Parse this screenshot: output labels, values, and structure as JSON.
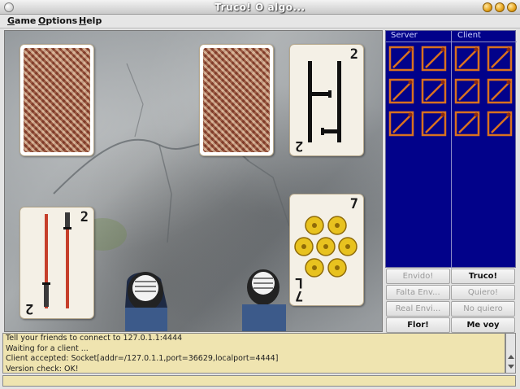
{
  "window": {
    "title": "Truco! O algo..."
  },
  "menu": [
    {
      "first": "G",
      "rest": "ame"
    },
    {
      "first": "O",
      "rest": "ptions"
    },
    {
      "first": "H",
      "rest": "elp"
    }
  ],
  "cards": {
    "opponent_played": {
      "rank": "2",
      "suit": "sword-icon"
    },
    "player_hand": {
      "rank": "2",
      "suit": "sword-icon"
    },
    "player_played": {
      "rank": "7",
      "suit": "coin-icon",
      "bottom_rank": "L"
    }
  },
  "score": {
    "server_label": "Server",
    "client_label": "Client",
    "server_points": 6,
    "client_points": 6
  },
  "buttons": {
    "envido": "Envido!",
    "truco": "Truco!",
    "falta_envido": "Falta Env...",
    "quiero": "Quiero!",
    "real_envido": "Real Envi...",
    "no_quiero": "No quiero",
    "flor": "Flor!",
    "me_voy": "Me voy"
  },
  "log": [
    "Tell your friends to connect to 127.0.1.1:4444",
    "Waiting for a client ...",
    "Client accepted: Socket[addr=/127.0.1.1,port=36629,localport=4444]",
    "Version check: OK!"
  ],
  "colors": {
    "score_bg": "#02028a",
    "log_bg": "#efe4b0",
    "match_stick": "#d9711f"
  }
}
